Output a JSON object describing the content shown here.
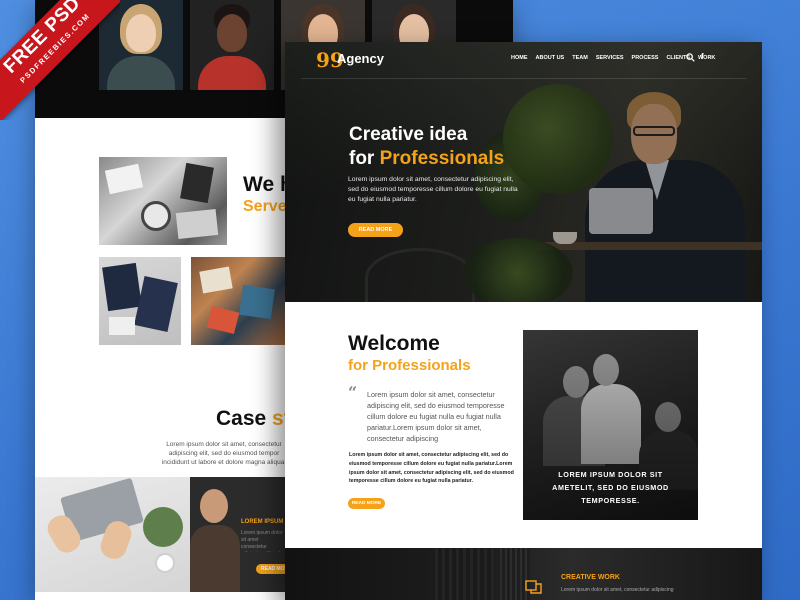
{
  "ribbon": {
    "title": "FREE PSD",
    "subtitle": "PSDFREEBIES.COM"
  },
  "back_page": {
    "heading_partial": "We h",
    "subheading_partial": "Serve",
    "case_title_partial": "Case",
    "case_title_highlight_partial": "st",
    "case_text": "Lorem ipsum dolor sit amet, consectetur adipiscing elit, sed do eiusmod tempor incididunt ut labore et dolore magna aliqua.",
    "orange_label_partial": "LOREM IPSUM DO",
    "gray_text": "Lorem ipsum dolor sit amet consectetur adipiscing elit sed do eiusmod",
    "button_partial": "READ MO"
  },
  "front_page": {
    "nav": {
      "logo_mark": "99",
      "logo_text": "Agency",
      "items": [
        "HOME",
        "ABOUT US",
        "TEAM",
        "SERVICES",
        "PROCESS",
        "CLIENTS",
        "WORK"
      ],
      "facebook_label": "f"
    },
    "hero": {
      "title_line1": "Creative idea",
      "title_line2_prefix": "for ",
      "title_line2_highlight": "Professionals",
      "text": "Lorem ipsum dolor sit amet, consectetur adipiscing elit, sed do eiusmod temporesse cillum dolore eu fugiat nulla eu fugiat nulla pariatur.",
      "button_label": "READ MORE"
    },
    "welcome": {
      "title": "Welcome",
      "subtitle": "for Professionals",
      "quote_mark": "“",
      "quote": "Lorem ipsum dolor sit amet, consectetur adipiscing elit, sed do eiusmod temporesse cillum dolore eu fugiat nulla eu fugiat nulla pariatur.Lorem ipsum dolor sit amet, consectetur adipiscing",
      "body": "Lorem ipsum dolor sit amet, consectetur adipiscing elit, sed do eiusmod temporesse cillum dolore eu fugiat nulla pariatur.Lorem ipsum dolor sit amet, consectetur adipiscing elit, sed do eiusmod temporesse cillum dolore eu fugiat nulla pariatur.",
      "button_label": "READ MORE",
      "image_caption": "LOREM IPSUM DOLOR SIT AMETELIT, SED DO EIUSMOD TEMPORESSE."
    },
    "services": {
      "label": "CREATIVE WORK",
      "text": "Lorem ipsum dolor sit amet, consectetur adipiscing"
    }
  },
  "colors": {
    "accent": "#f5a21b",
    "background": "#3a78d2",
    "ribbon": "#c8161d",
    "dark": "#111111"
  },
  "icons": [
    "search-icon",
    "facebook-icon",
    "quote-icon",
    "creative-work-icon"
  ]
}
